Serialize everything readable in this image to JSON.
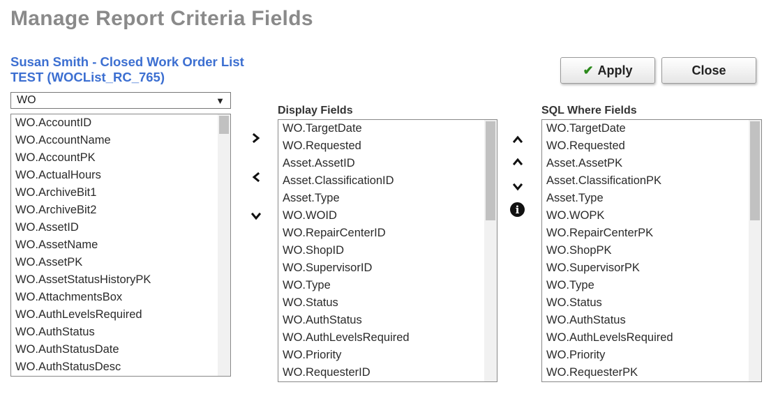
{
  "page": {
    "title": "Manage Report Criteria Fields",
    "report_name": "Susan Smith - Closed Work Order List TEST (WOCList_RC_765)"
  },
  "toolbar": {
    "apply_label": "Apply",
    "close_label": "Close"
  },
  "table_select": {
    "selected": "WO"
  },
  "available_fields": {
    "items": [
      "WO.AccountID",
      "WO.AccountName",
      "WO.AccountPK",
      "WO.ActualHours",
      "WO.ArchiveBit1",
      "WO.ArchiveBit2",
      "WO.AssetID",
      "WO.AssetName",
      "WO.AssetPK",
      "WO.AssetStatusHistoryPK",
      "WO.AttachmentsBox",
      "WO.AuthLevelsRequired",
      "WO.AuthStatus",
      "WO.AuthStatusDate",
      "WO.AuthStatusDesc"
    ]
  },
  "display_fields": {
    "header": "Display Fields",
    "items": [
      "WO.TargetDate",
      "WO.Requested",
      "Asset.AssetID",
      "Asset.ClassificationID",
      "Asset.Type",
      "WO.WOID",
      "WO.RepairCenterID",
      "WO.ShopID",
      "WO.SupervisorID",
      "WO.Type",
      "WO.Status",
      "WO.AuthStatus",
      "WO.AuthLevelsRequired",
      "WO.Priority",
      "WO.RequesterID"
    ]
  },
  "sql_where_fields": {
    "header": "SQL Where Fields",
    "items": [
      "WO.TargetDate",
      "WO.Requested",
      "Asset.AssetPK",
      "Asset.ClassificationPK",
      "Asset.Type",
      "WO.WOPK",
      "WO.RepairCenterPK",
      "WO.ShopPK",
      "WO.SupervisorPK",
      "WO.Type",
      "WO.Status",
      "WO.AuthStatus",
      "WO.AuthLevelsRequired",
      "WO.Priority",
      "WO.RequesterPK"
    ]
  },
  "icons": {
    "move_right": "chevron-right-icon",
    "move_left": "chevron-left-icon",
    "move_down_left": "chevron-down-icon",
    "move_up_top": "chevron-up-icon",
    "move_up": "chevron-up-icon",
    "move_down": "chevron-down-icon",
    "info": "info-icon"
  },
  "colors": {
    "title": "#8a8a8a",
    "report_name": "#3c6fd1",
    "check": "#2c8a1c"
  }
}
